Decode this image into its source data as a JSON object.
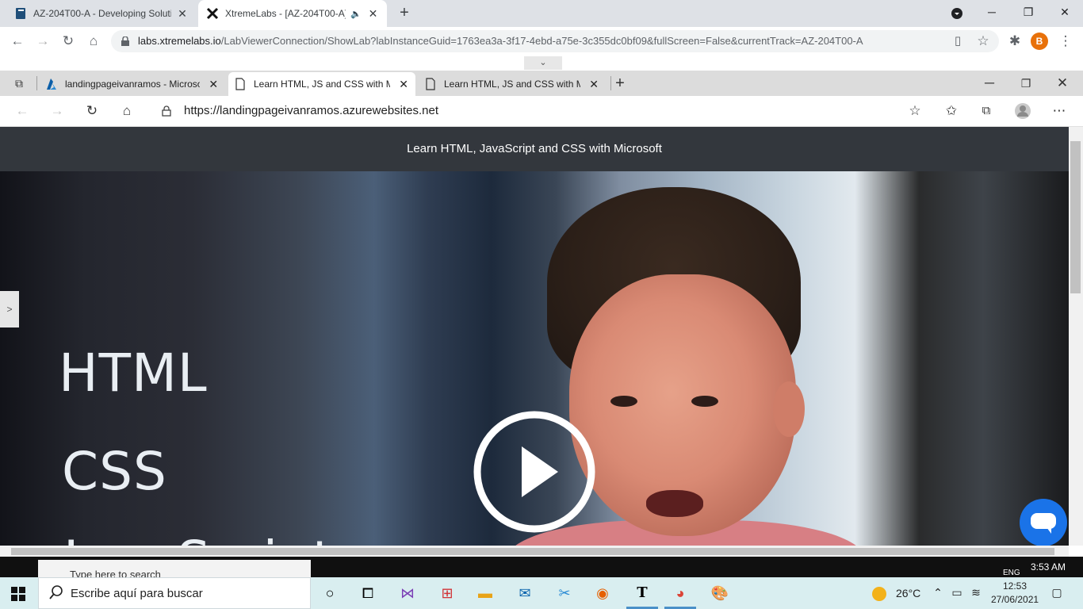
{
  "outer_browser": {
    "tabs": [
      {
        "title": "AZ-204T00-A - Developing Soluti"
      },
      {
        "title": "XtremeLabs - [AZ-204T00-A]"
      }
    ],
    "url_host": "labs.xtremelabs.io",
    "url_path": "/LabViewerConnection/ShowLab?labInstanceGuid=1763ea3a-3f17-4ebd-a75e-3c355dc0bf09&fullScreen=False&currentTrack=AZ-204T00-A",
    "profile_initial": "B",
    "collapse_glyph": "⌄"
  },
  "inner_browser": {
    "tabs": [
      {
        "title": "landingpageivanramos - Microso"
      },
      {
        "title": "Learn HTML, JS and CSS with Mic"
      },
      {
        "title": "Learn HTML, JS and CSS with Mic"
      }
    ],
    "url": "https://landingpageivanramos.azurewebsites.net"
  },
  "page": {
    "header_title": "Learn HTML, JavaScript and CSS with Microsoft",
    "video_words": [
      "HTML",
      "CSS",
      "JavaScript"
    ],
    "side_tab_glyph": ">"
  },
  "inner_taskbar": {
    "search_placeholder": "Type here to search",
    "lang": "ENG",
    "time": "3:53 AM"
  },
  "taskbar": {
    "search_placeholder": "Escribe aquí para buscar",
    "temperature": "26°C",
    "time": "12:53",
    "date": "27/06/2021"
  },
  "colors": {
    "page_header_bg": "#33373d",
    "chat_button": "#1a73e8",
    "profile_avatar": "#e8710a"
  }
}
